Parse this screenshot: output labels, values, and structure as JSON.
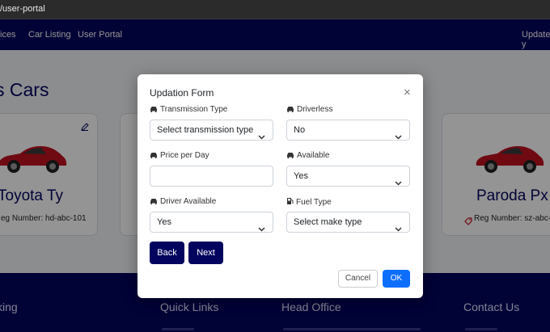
{
  "browser": {
    "url": "/user-portal"
  },
  "navbar": {
    "items": [
      "ices",
      "Car Listing",
      "User Portal"
    ],
    "right_label": "Update y"
  },
  "main": {
    "section_title": "s Cars",
    "cards": [
      {
        "name": "Toyota Ty",
        "reg": "eg Number: hd-abc-101"
      },
      {
        "name": "Paroda Px",
        "reg": "Reg Number: sz-abc-1"
      }
    ]
  },
  "modal": {
    "title": "Updation Form",
    "close_symbol": "×",
    "fields": {
      "transmission": {
        "label": "Transmission Type",
        "value": "Select transmission type"
      },
      "driverless": {
        "label": "Driverless",
        "value": "No"
      },
      "price": {
        "label": "Price per Day",
        "value": ""
      },
      "available": {
        "label": "Available",
        "value": "Yes"
      },
      "driver_available": {
        "label": "Driver Available",
        "value": "Yes"
      },
      "fuel": {
        "label": "Fuel Type",
        "value": "Select make type"
      }
    },
    "buttons": {
      "back": "Back",
      "next": "Next",
      "cancel": "Cancel",
      "ok": "OK"
    }
  },
  "footer": {
    "headings": [
      "king",
      "Quick Links",
      "Head Office",
      "Contact Us"
    ]
  },
  "colors": {
    "navy": "#03045e",
    "primary": "#0d6efd",
    "car_red": "#c1121f"
  }
}
